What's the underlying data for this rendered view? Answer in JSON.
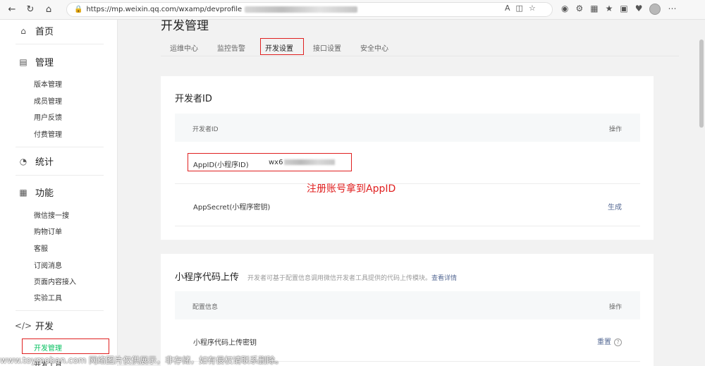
{
  "browser": {
    "url_prefix": "https://mp.weixin.qq.com/wxamp/devprofile",
    "read_aloud": "A",
    "icons": [
      "back-icon",
      "refresh-icon",
      "home-icon",
      "lock-icon"
    ]
  },
  "sidebar": {
    "groups": [
      {
        "label": "首页",
        "icon": "home-icon"
      },
      {
        "label": "管理",
        "icon": "inbox-icon"
      },
      {
        "label": "统计",
        "icon": "pie-chart-icon"
      },
      {
        "label": "功能",
        "icon": "grid-icon"
      },
      {
        "label": "开发",
        "icon": "code-icon"
      }
    ],
    "manage_items": [
      "版本管理",
      "成员管理",
      "用户反馈",
      "付费管理"
    ],
    "feature_items": [
      "微信搜一搜",
      "购物订单",
      "客服",
      "订阅消息",
      "页面内容接入",
      "实验工具"
    ],
    "dev_items": [
      "开发管理",
      "开发工具"
    ]
  },
  "main": {
    "title": "开发管理",
    "tabs": [
      "运维中心",
      "监控告警",
      "开发设置",
      "接口设置",
      "安全中心"
    ],
    "active_tab": "开发设置"
  },
  "developer_id": {
    "title": "开发者ID",
    "header_left": "开发者ID",
    "header_right": "操作",
    "rows": [
      {
        "label": "AppID(小程序ID)",
        "value": "wx6",
        "action": ""
      },
      {
        "label": "AppSecret(小程序密钥)",
        "value": "",
        "action": "生成"
      }
    ],
    "annotation": "注册账号拿到AppID"
  },
  "code_upload": {
    "title": "小程序代码上传",
    "desc": "开发者可基于配置信息调用微信开发者工具提供的代码上传模块。",
    "desc_link": "查看详情",
    "header_left": "配置信息",
    "header_right": "操作",
    "row_label": "小程序代码上传密钥",
    "row_action": "重置",
    "help": "?"
  },
  "watermark": "www.toymoban.com 网络图片仅供展示，非存储，如有侵权请联系删除。",
  "colors": {
    "accent_green": "#07c160",
    "highlight_red": "#e02020",
    "link_blue": "#576b95"
  }
}
